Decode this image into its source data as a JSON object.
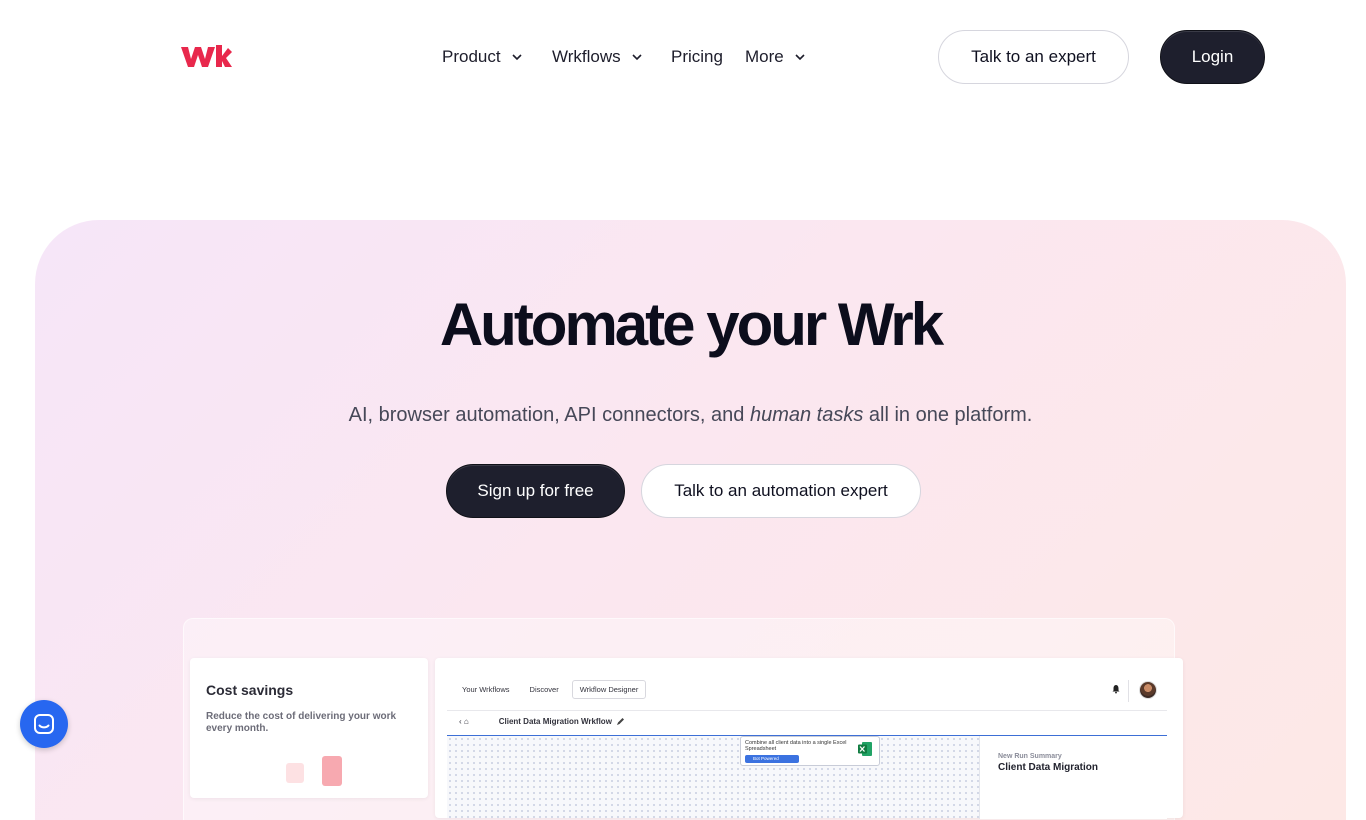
{
  "header": {
    "logo_alt": "wrk",
    "nav": [
      {
        "label": "Product",
        "has_dropdown": true
      },
      {
        "label": "Wrkflows",
        "has_dropdown": true
      },
      {
        "label": "Pricing",
        "has_dropdown": false
      },
      {
        "label": "More",
        "has_dropdown": true
      }
    ],
    "talk_label": "Talk to an expert",
    "login_label": "Login"
  },
  "hero": {
    "title": "Automate your Wrk",
    "subtitle_before": "AI, browser automation, API connectors, and ",
    "subtitle_em": "human tasks",
    "subtitle_after": " all in one platform.",
    "signup_label": "Sign up for free",
    "automation_label": "Talk to an automation expert"
  },
  "preview": {
    "cost_card": {
      "title": "Cost savings",
      "description": "Reduce the cost of delivering your work every month."
    },
    "app": {
      "tabs": [
        "Your Wrkflows",
        "Discover",
        "Wrkflow Designer"
      ],
      "active_tab": "Wrkflow Designer",
      "crumb_prefix": "‹ ⌂",
      "workflow_title": "Client Data Migration Wrkflow",
      "node_text": "Combine all client data into a single Excel Spreadsheet",
      "node_badge": "Bot Powered",
      "summary_label": "New Run Summary",
      "summary_title": "Client Data Migration"
    }
  },
  "colors": {
    "brand": "#e8284c",
    "dark_button": "#1e1f2d",
    "chat_blue": "#2767f0"
  }
}
